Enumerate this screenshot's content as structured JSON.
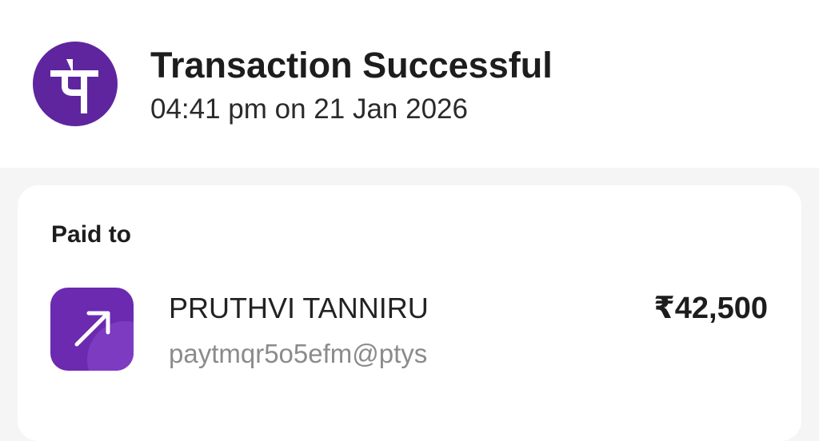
{
  "header": {
    "logo_icon": "phonepe-logo-icon",
    "title": "Transaction Successful",
    "timestamp": "04:41 pm on 21 Jan 2026"
  },
  "paid_to": {
    "label": "Paid to",
    "avatar_icon": "arrow-up-right-icon",
    "name": "PRUTHVI TANNIRU",
    "upi_id": "paytmqr5o5efm@ptys",
    "amount": "₹42,500"
  },
  "colors": {
    "brand_purple": "#5f259f",
    "avatar_purple": "#6b2ab0",
    "page_background": "#f5f5f5",
    "secondary_text": "#8b8b8b"
  }
}
